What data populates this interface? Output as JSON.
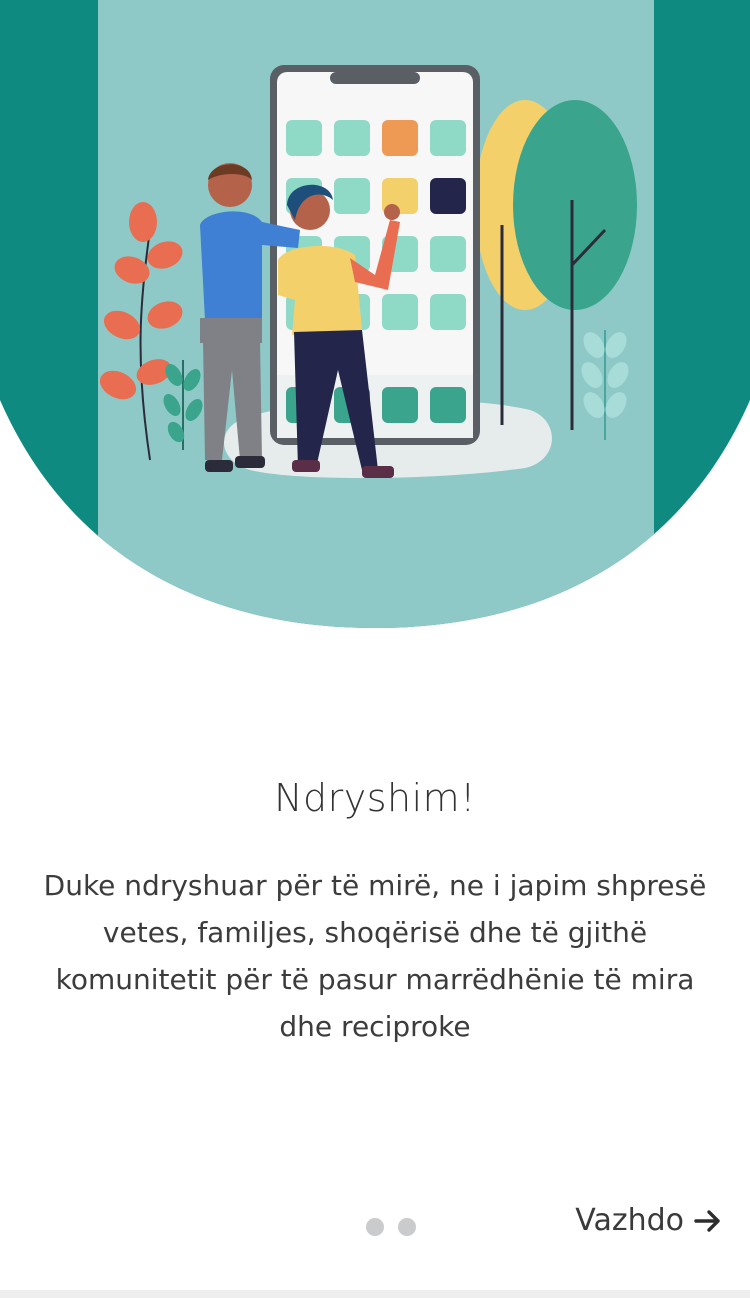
{
  "onboarding": {
    "title": "Ndryshim!",
    "description": "Duke ndryshuar për të mirë, ne i japim shpresë vetes, familjes, shoqërisë dhe të gjithë komunitetit për të pasur marrëdhënie të mira dhe reciproke",
    "pagination": {
      "total_pages": 2
    },
    "continue_label": "Vazhdo",
    "continue_icon": "arrow-right-icon"
  },
  "colors": {
    "teal_dark": "#0f8a80",
    "teal_light": "#8fc9c7",
    "accent_orange": "#ee9a55",
    "accent_yellow": "#f4d06a",
    "accent_red": "#e96d50"
  }
}
